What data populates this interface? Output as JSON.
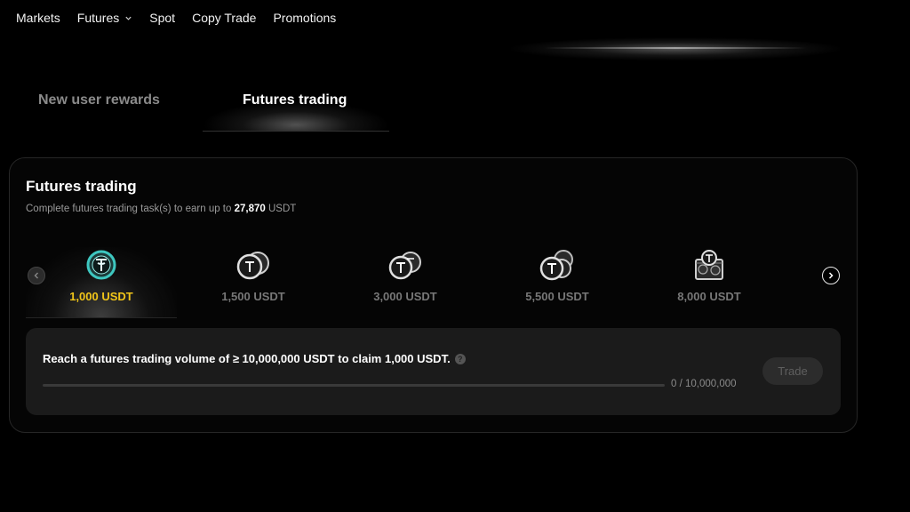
{
  "nav": {
    "items": [
      {
        "label": "Markets"
      },
      {
        "label": "Futures",
        "has_dropdown": true
      },
      {
        "label": "Spot"
      },
      {
        "label": "Copy Trade"
      },
      {
        "label": "Promotions"
      }
    ]
  },
  "tabs": {
    "inactive": "New user rewards",
    "active": "Futures trading"
  },
  "card": {
    "title": "Futures trading",
    "subtitle_prefix": "Complete futures trading task(s) to earn up to ",
    "subtitle_amount": "27,870",
    "subtitle_suffix": " USDT"
  },
  "tiers": [
    {
      "amount": "1,000 USDT",
      "active": true,
      "icon": "tether-coin-icon"
    },
    {
      "amount": "1,500 USDT",
      "active": false,
      "icon": "tether-coin-pair-icon"
    },
    {
      "amount": "3,000 USDT",
      "active": false,
      "icon": "tether-coin-pair-icon"
    },
    {
      "amount": "5,500 USDT",
      "active": false,
      "icon": "tether-coin-stack-icon"
    },
    {
      "amount": "8,000 USDT",
      "active": false,
      "icon": "tether-coin-box-icon"
    }
  ],
  "task": {
    "description": "Reach a futures trading volume of ≥ 10,000,000 USDT to claim 1,000 USDT.",
    "progress_label": "0 / 10,000,000",
    "progress_fraction": 0,
    "button_label": "Trade"
  },
  "colors": {
    "accent_gold": "#f0c419",
    "teal_coin": "#3ec7c0",
    "card_bg": "#050505",
    "task_bg": "#1b1b1b"
  }
}
